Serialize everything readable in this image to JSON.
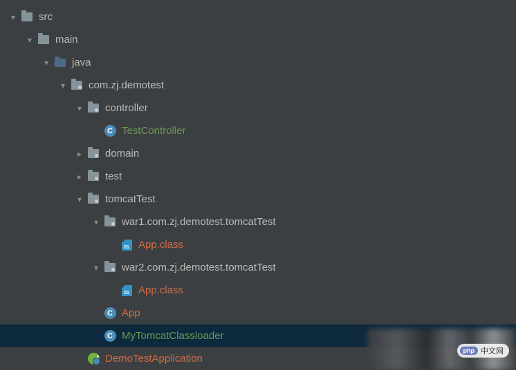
{
  "tree": {
    "src": "src",
    "main": "main",
    "java": "java",
    "pkg_root": "com.zj.demotest",
    "controller": "controller",
    "test_controller": "TestController",
    "domain": "domain",
    "test": "test",
    "tomcat_test": "tomcatTest",
    "war1": "war1.com.zj.demotest.tomcatTest",
    "war2": "war2.com.zj.demotest.tomcatTest",
    "app_class": "App.class",
    "app": "App",
    "my_tomcat_classloader": "MyTomcatClassloader",
    "demo_test_application": "DemoTestApplication"
  },
  "watermark": {
    "badge": "php",
    "text": "中文网"
  }
}
